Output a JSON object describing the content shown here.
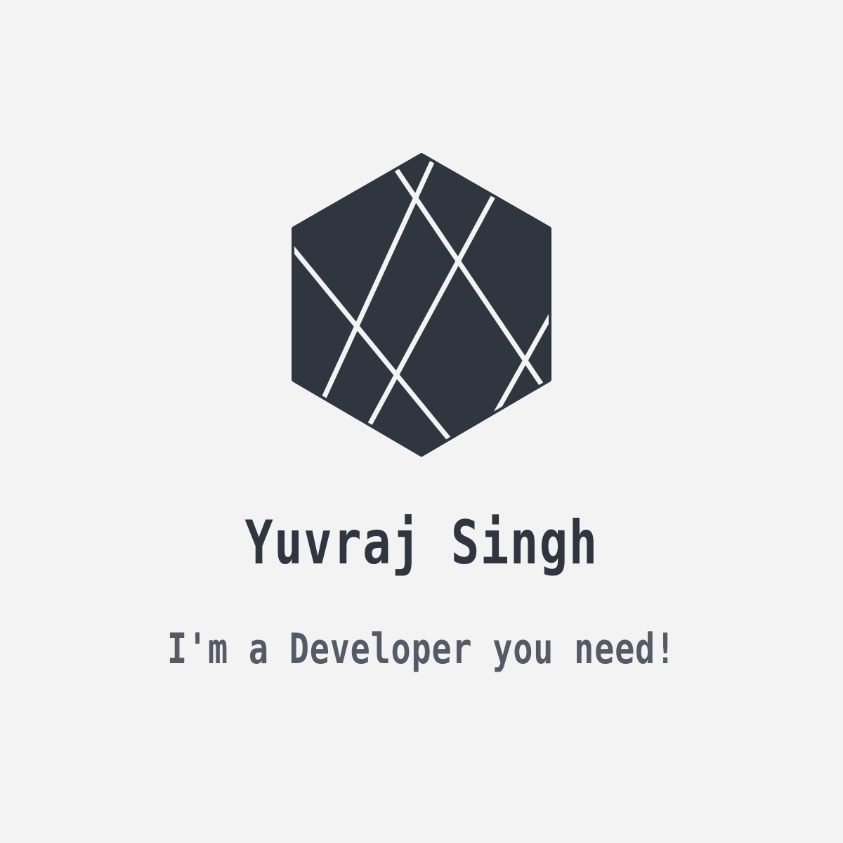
{
  "brand": {
    "logo_icon": "faceted-hexagon-icon",
    "name": "Yuvraj Singh",
    "tagline": "I'm a Developer you need!"
  },
  "colors": {
    "background": "#f3f3f3",
    "logo": "#2f3640",
    "name_text": "#2f3640",
    "tagline_text": "#545b66"
  }
}
